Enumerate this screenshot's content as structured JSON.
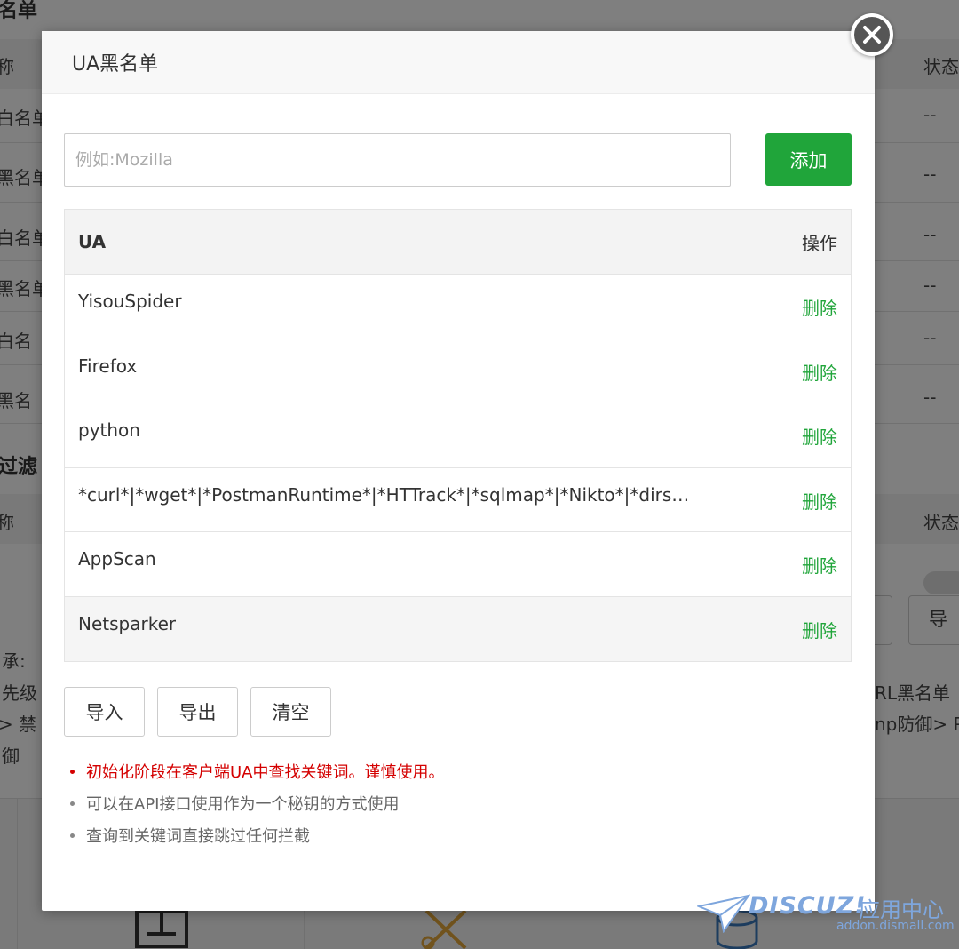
{
  "background": {
    "rows_top": [
      "名单",
      "称",
      "白名单",
      "黑名单",
      "白名单",
      "黑名单",
      "白名",
      "黑名"
    ],
    "status_header": "状态",
    "status_values": [
      "--",
      "--",
      "--",
      "--",
      "--",
      "--"
    ],
    "section2_title": "过滤",
    "section2_col": "称",
    "section2_status": "状态",
    "left_notes": [
      "承:",
      "先级",
      "> 禁",
      "御"
    ],
    "right_notes": [
      "RL黑名单",
      "np防御> P"
    ],
    "right_btn": "导"
  },
  "modal": {
    "title": "UA黑名单",
    "input_placeholder": "例如:Mozilla",
    "add_label": "添加",
    "table": {
      "col_ua": "UA",
      "col_op": "操作",
      "rows": [
        {
          "ua": "YisouSpider",
          "action": "删除"
        },
        {
          "ua": "Firefox",
          "action": "删除"
        },
        {
          "ua": "python",
          "action": "删除"
        },
        {
          "ua": "*curl*|*wget*|*PostmanRuntime*|*HTTrack*|*sqlmap*|*Nikto*|*dirsea...",
          "action": "删除"
        },
        {
          "ua": "AppScan",
          "action": "删除"
        },
        {
          "ua": "Netsparker",
          "action": "删除"
        }
      ]
    },
    "buttons": {
      "import": "导入",
      "export": "导出",
      "clear": "清空"
    },
    "tips": [
      "初始化阶段在客户端UA中查找关键词。谨慎使用。",
      "可以在API接口使用作为一个秘钥的方式使用",
      "查询到关键词直接跳过任何拦截"
    ]
  },
  "watermark": {
    "logo": "DISCUZ!",
    "app": "应用中心",
    "url": "addon.dismall.com"
  },
  "colors": {
    "accent": "#20a53a",
    "warning": "#d40000",
    "watermark": "#7ea6dd"
  }
}
